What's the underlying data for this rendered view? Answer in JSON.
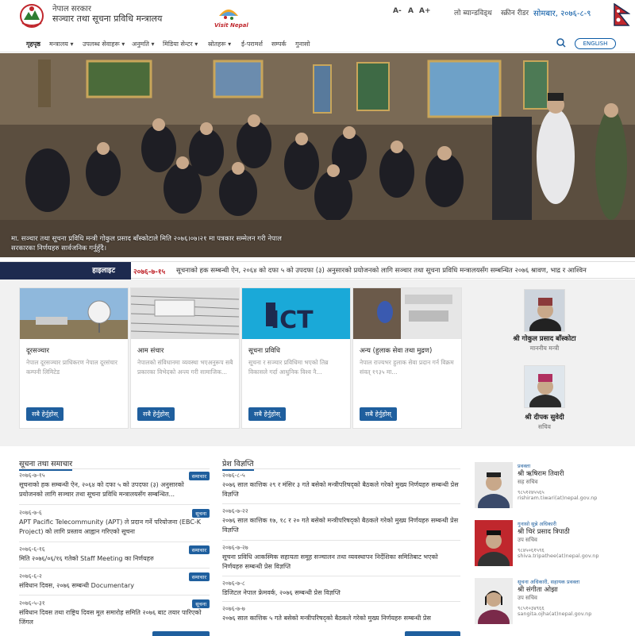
{
  "header": {
    "gov_line1": "नेपाल सरकार",
    "gov_line2": "सञ्चार तथा सूचना प्रविधि मन्त्रालय",
    "visit_text": "Visit Nepal",
    "font_small": "A-",
    "font_normal": "A",
    "font_large": "A+",
    "low_bandwidth": "लो ब्यान्डविड्थ",
    "screen_reader": "स्क्रीन रीडर",
    "date": "सोमबार, २०७६-८-९",
    "english_button": "ENGLISH"
  },
  "nav": {
    "items": [
      "गृहपृष्ठ",
      "मन्त्रालय",
      "उपलब्ध सेवाहरू",
      "अनुमति",
      "मिडिया सेन्टर",
      "स्रोतहरू",
      "ई-परामर्श",
      "सम्पर्क",
      "गुनासो"
    ]
  },
  "hero": {
    "caption": "मा. सञ्चार तथा सूचना प्रविधि मन्त्री गोकुल प्रसाद बाँस्कोटाले मिति २०७६।०७।२१ मा पत्रकार सम्मेलन गरी नेपाल सरकारका निर्णयहरु सार्वजनिक गर्नुहुँदै।"
  },
  "highlight": {
    "label": "हाइलाइट",
    "date": "२०७६-७-१५",
    "text": "सूचनाको हक सम्बन्धी ऐन, २०६४ को दफा ५ को उपदफा (३) अनुसारको प्रयोजनको लागि सञ्चार तथा सूचना प्रविधि मन्त्रालयसँग सम्बन्धित २०७६ श्रावण, भाद्र र आश्विन"
  },
  "cards": [
    {
      "title": "दूरसञ्चार",
      "desc": "नेपाल दूरसञ्चार प्राधिकरण नेपाल दूरसंचार कम्पनी लिमिटेड",
      "button": "सबै हेर्नुहोस्"
    },
    {
      "title": "आम संचार",
      "desc": "नेपालको संविधानमा व्यवस्था भएअनुरूप सबै प्रकारका विभेदको अन्त्य गरी सामाजिक...",
      "button": "सबै हेर्नुहोस्"
    },
    {
      "title": "सूचना प्रविधि",
      "desc": "सूचना र सञ्चार प्रविधिमा भएको तिब्र विकासले गर्दा आधुनिक विश्व नै...",
      "button": "सबै हेर्नुहोस्"
    },
    {
      "title": "अन्य (हुलाक सेवा तथा मुद्रण)",
      "desc": "नेपाल राज्यभर हुलाक सेवा प्रदान गर्न विक्रम संवत् १९३५ मा...",
      "button": "सबै हेर्नुहोस्"
    }
  ],
  "ict_logo_text": "ICT",
  "officials": [
    {
      "name": "श्री गोकुल प्रसाद बाँस्कोटा",
      "role": "माननीय मन्त्री"
    },
    {
      "name": "श्री दीपक सुवेदी",
      "role": "सचिव"
    }
  ],
  "news": {
    "title": "सूचना तथा समाचार",
    "items": [
      {
        "date": "२०७६-७-१५",
        "tag": "समाचार",
        "text": "सूचनाको हक सम्बन्धी ऐन, २०६४ को दफा ५ को उपदफा (३) अनुसारको प्रयोजनको लागि सञ्चार तथा सूचना प्रविधि मन्त्रालयसँग सम्बन्धित..."
      },
      {
        "date": "२०७६-७-६",
        "tag": "सूचना",
        "text": "APT Pacific Telecommunity (APT) ले प्रदान गर्ने परियोजना (EBC-K Project) को लागि प्रस्ताव आह्वान गरिएको सूचना"
      },
      {
        "date": "२०७६-६-१६",
        "tag": "समाचार",
        "text": "मिति २०७६/०६/१६ गतेको Staff Meeting का निर्णयहरु"
      },
      {
        "date": "२०७६-६-२",
        "tag": "समाचार",
        "text": "संविधान दिवस, २०७६ सम्बन्धी Documentary"
      },
      {
        "date": "२०७६-५-३१",
        "tag": "सूचना",
        "text": "संविधान दिवस तथा राष्ट्रिय दिवस मूल समारोह समिति २०७६ बाट तयार पारिएको जिंगल"
      }
    ]
  },
  "press": {
    "title": "प्रेश विज्ञप्ति",
    "items": [
      {
        "date": "२०७६-८-५",
        "text": "२०७६ साल कात्तिक २९ र मंसिर ३ गते बसेको मन्त्रीपरिषद्को बैठकले गरेको मुख्य निर्णयहरु सम्बन्धी प्रेस विज्ञप्ति"
      },
      {
        "date": "२०७६-७-२२",
        "text": "२०७६ साल कात्तिक १७, १८ र २० गते बसेको मन्त्रीपरिषद्को बैठकले गरेको मुख्य निर्णयहरु सम्बन्धी प्रेस विज्ञप्ति"
      },
      {
        "date": "२०७६-७-२७",
        "text": "सूचना प्रविधि आकस्मिक सहायता समूह सञ्चालन तथा व्यवस्थापन निर्देशिका समितिबाट भएको निर्णयहरु सम्बन्धी प्रेस विज्ञप्ति"
      },
      {
        "date": "२०७६-७-८",
        "text": "डिजिटल नेपाल फ्रेमवर्क, २०७६ सम्बन्धी प्रेस विज्ञप्ति"
      },
      {
        "date": "२०७६-७-७",
        "text": "२०७६ साल कात्तिक ५ गते बसेको मन्त्रीपरिषद्को बैठकले गरेको मुख्य निर्णयहरु सम्बन्धी प्रेस"
      }
    ]
  },
  "contacts": [
    {
      "role1": "प्रवक्ता",
      "name": "श्री ऋषिराम तिवारी",
      "role2": "सह सचिव",
      "phone": "९८५१२४५५६५",
      "email": "rishiram.tiwari(at)nepal.gov.np"
    },
    {
      "role1": "गुनासो सुन्ने अधिकारी",
      "name": "श्री चिरं प्रसाद त्रिपाठी",
      "role2": "उप सचिव",
      "phone": "९८४५०६१५९६",
      "email": "shiva.tripathee(at)nepal.gov.np"
    },
    {
      "role1": "सूचना अधिकारी, सहायक प्रवक्ता",
      "name": "श्री संगीता ओझा",
      "role2": "उप सचिव",
      "phone": "९८५१०३४९६६",
      "email": "sangita.ojha(at)nepal.gov.np"
    }
  ],
  "colors": {
    "brand_blue": "#1f5f9e",
    "highlight_bar": "#1d2a4f",
    "date_red": "#c0272d"
  }
}
